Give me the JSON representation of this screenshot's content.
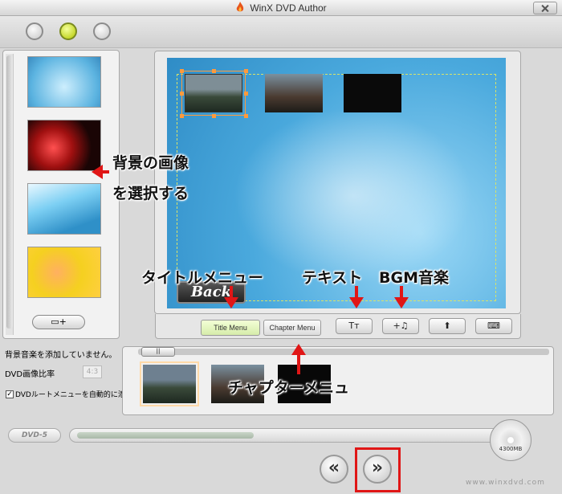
{
  "window": {
    "title": "WinX DVD Author"
  },
  "toolbar": {
    "circles": [
      "circle-1",
      "circle-2",
      "circle-3"
    ]
  },
  "left_panel": {
    "add_button_label": "▭+"
  },
  "preview": {
    "back_button_label": "Back"
  },
  "tabs": {
    "title_menu": "Title Menu",
    "chapter_menu": "Chapter Menu"
  },
  "tools": {
    "text": "Tт",
    "bgm": "+♫",
    "up": "⬆",
    "keyboard": "⌨"
  },
  "info": {
    "bgm_status": "背景音楽を添加していません。",
    "ratio_label": "DVD画像比率",
    "ratio_value": "4:3",
    "auto_menu_label": "DVDルートメニューを自動的に添加する",
    "checkbox_checked": "✓"
  },
  "capacity": {
    "dvd_label": "DVD-5",
    "disc_size": "4300MB"
  },
  "nav": {
    "prev": "«",
    "next": "»"
  },
  "watermark": "www.winxdvd.com",
  "annotations": {
    "bg_image_line1": "背景の画像",
    "bg_image_line2": "を選択する",
    "title_menu": "タイトルメニュー",
    "text": "テキスト",
    "bgm": "BGM音楽",
    "chapter_menu": "チャプターメニュ"
  },
  "colors": {
    "accent_red": "#e01616",
    "selection_orange": "#ff9a3c",
    "active_green": "#b3c800"
  }
}
